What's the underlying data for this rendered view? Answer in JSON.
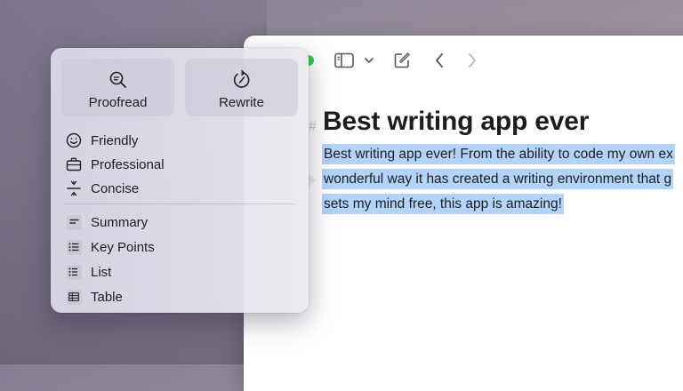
{
  "colors": {
    "selection": "#b3d3fb",
    "window_bg": "#ffffff",
    "traffic_green": "#33c748"
  },
  "toolbar": {
    "icons": [
      "sidebar-icon",
      "chevron-down-icon",
      "compose-icon",
      "back-icon",
      "forward-icon"
    ]
  },
  "document": {
    "heading_marker": "#",
    "title": "Best writing app ever",
    "lines": [
      "Best writing app ever! From the ability to code my own ex",
      "wonderful way it has created a writing environment that g",
      "sets my mind free, this app is amazing!"
    ]
  },
  "writing_tools": {
    "actions": [
      {
        "label": "Proofread",
        "icon": "proofread-icon"
      },
      {
        "label": "Rewrite",
        "icon": "rewrite-icon"
      }
    ],
    "tone_items": [
      {
        "label": "Friendly",
        "icon": "smiley-icon"
      },
      {
        "label": "Professional",
        "icon": "briefcase-icon"
      },
      {
        "label": "Concise",
        "icon": "concise-icon"
      }
    ],
    "format_items": [
      {
        "label": "Summary",
        "icon": "summary-icon"
      },
      {
        "label": "Key Points",
        "icon": "key-points-icon"
      },
      {
        "label": "List",
        "icon": "list-icon"
      },
      {
        "label": "Table",
        "icon": "table-icon"
      }
    ]
  }
}
